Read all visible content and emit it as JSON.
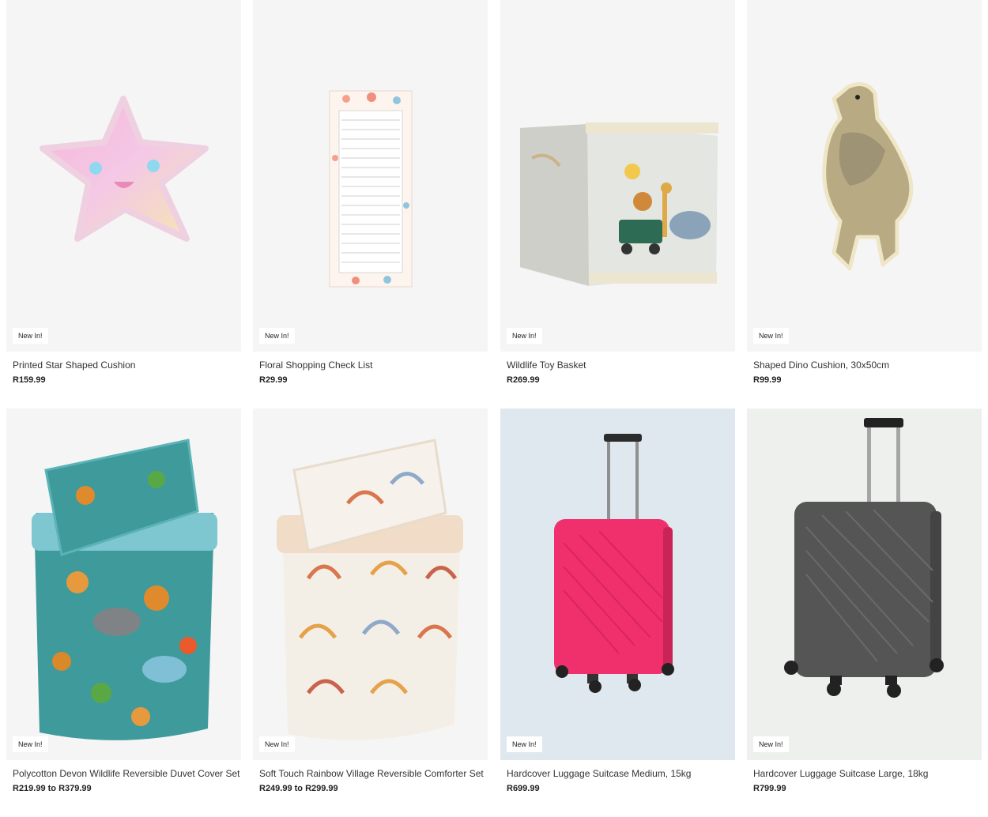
{
  "products": [
    {
      "name": "Printed Star Shaped Cushion",
      "price": "R159.99",
      "badge": "New In!"
    },
    {
      "name": "Floral Shopping Check List",
      "price": "R29.99",
      "badge": "New In!"
    },
    {
      "name": "Wildlife Toy Basket",
      "price": "R269.99",
      "badge": "New In!"
    },
    {
      "name": "Shaped Dino Cushion, 30x50cm",
      "price": "R99.99",
      "badge": "New In!"
    },
    {
      "name": "Polycotton Devon Wildlife Reversible Duvet Cover Set",
      "price": "R219.99 to R379.99",
      "badge": "New In!"
    },
    {
      "name": "Soft Touch Rainbow Village Reversible Comforter Set",
      "price": "R249.99 to R299.99",
      "badge": "New In!"
    },
    {
      "name": "Hardcover Luggage Suitcase Medium, 15kg",
      "price": "R699.99",
      "badge": "New In!"
    },
    {
      "name": "Hardcover Luggage Suitcase Large, 18kg",
      "price": "R799.99",
      "badge": "New In!"
    }
  ],
  "colors": {
    "image_bg": "#f5f5f5",
    "suitcase_pink": "#f0306c",
    "suitcase_grey": "#555555",
    "duvet_teal": "#3f9a9c"
  }
}
